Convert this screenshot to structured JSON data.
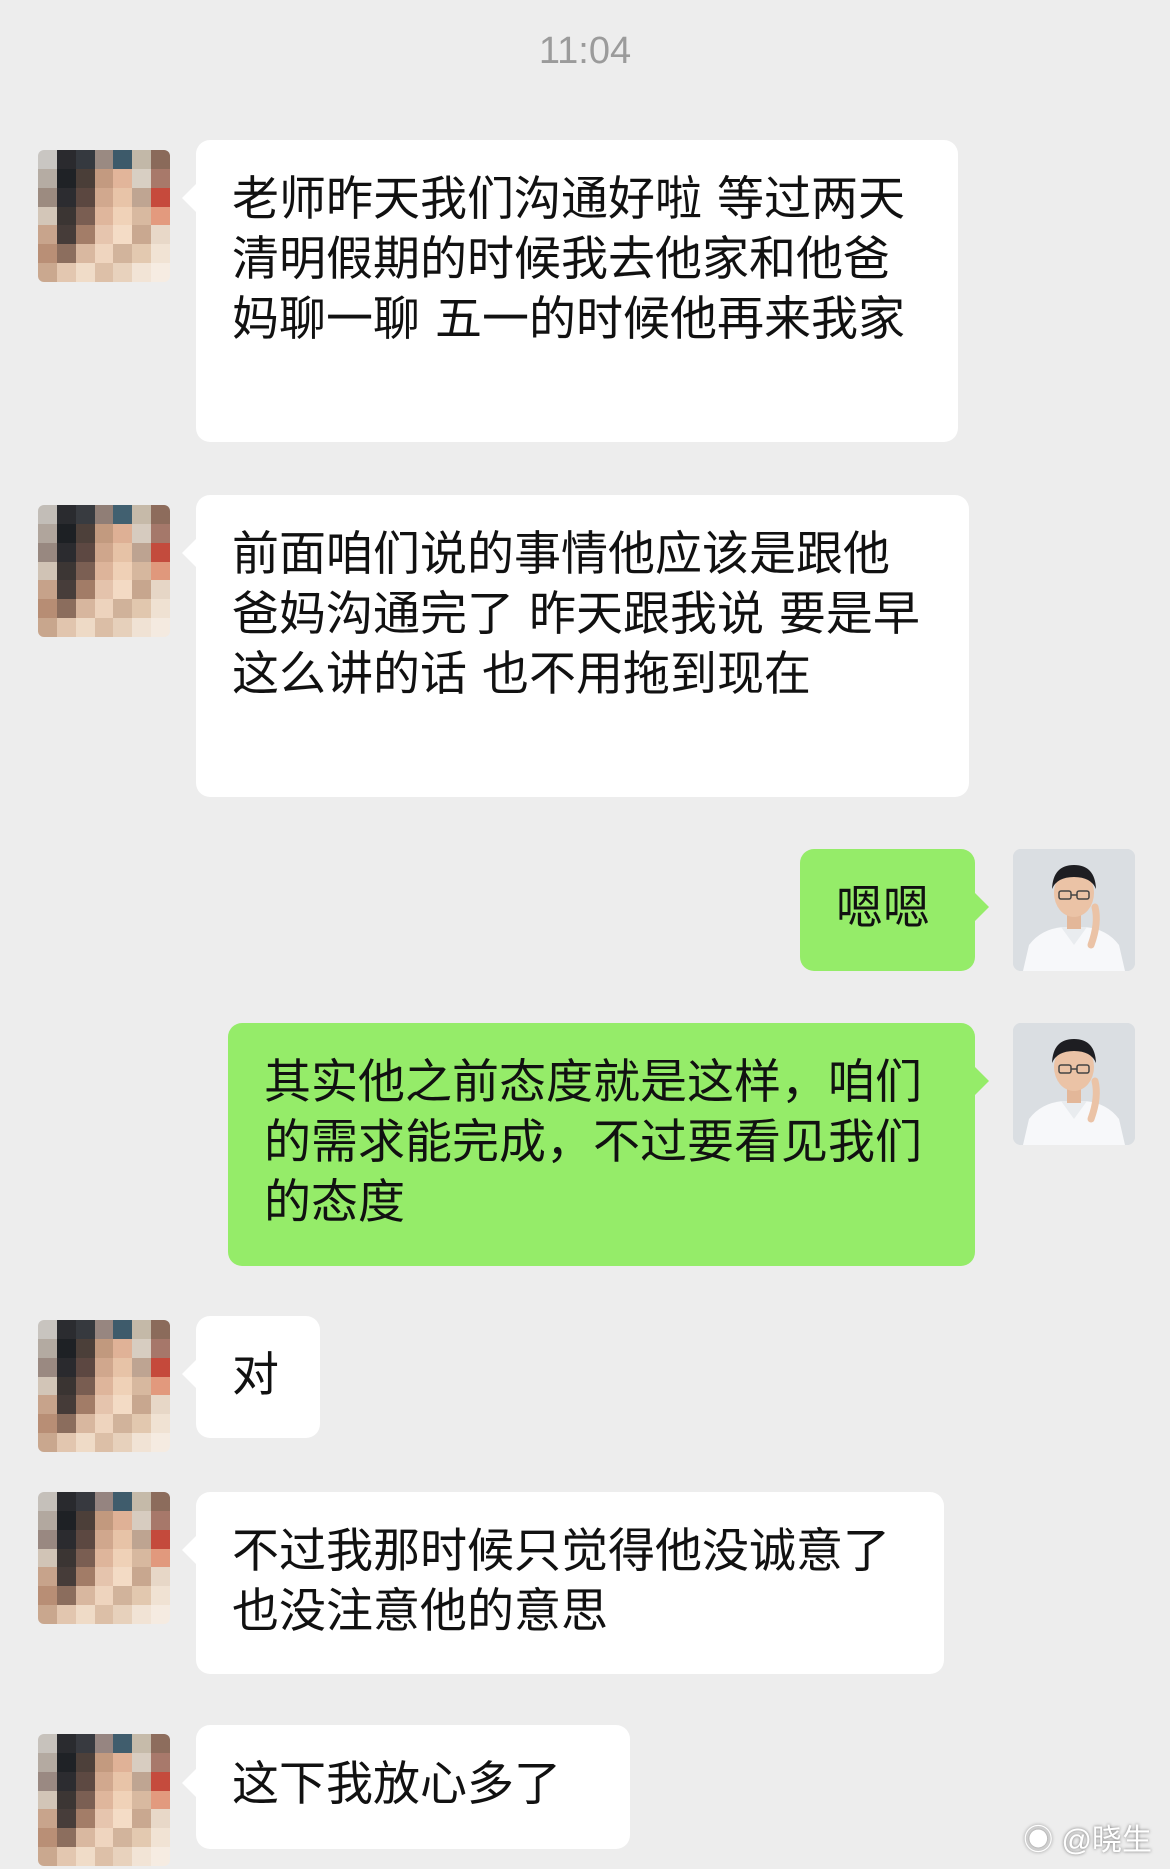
{
  "header": {
    "time": "11:04"
  },
  "messages": [
    {
      "side": "in",
      "text": "老师昨天我们沟通好啦 等过两天清明假期的时候我去他家和他爸妈聊一聊 五一的时候他再来我家"
    },
    {
      "side": "in",
      "text": "前面咱们说的事情他应该是跟他爸妈沟通完了 昨天跟我说 要是早这么讲的话 也不用拖到现在"
    },
    {
      "side": "out",
      "text": "嗯嗯"
    },
    {
      "side": "out",
      "text": "其实他之前态度就是这样，咱们的需求能完成，不过要看见我们的态度"
    },
    {
      "side": "in",
      "text": "对"
    },
    {
      "side": "in",
      "text": "不过我那时候只觉得他没诚意了 也没注意他的意思"
    },
    {
      "side": "in",
      "text": "这下我放心多了"
    }
  ],
  "watermark": {
    "text": "@晓生"
  },
  "colors": {
    "background": "#ededed",
    "incoming": "#ffffff",
    "outgoing": "#95ec69",
    "timestamp": "#9b9b9b"
  }
}
